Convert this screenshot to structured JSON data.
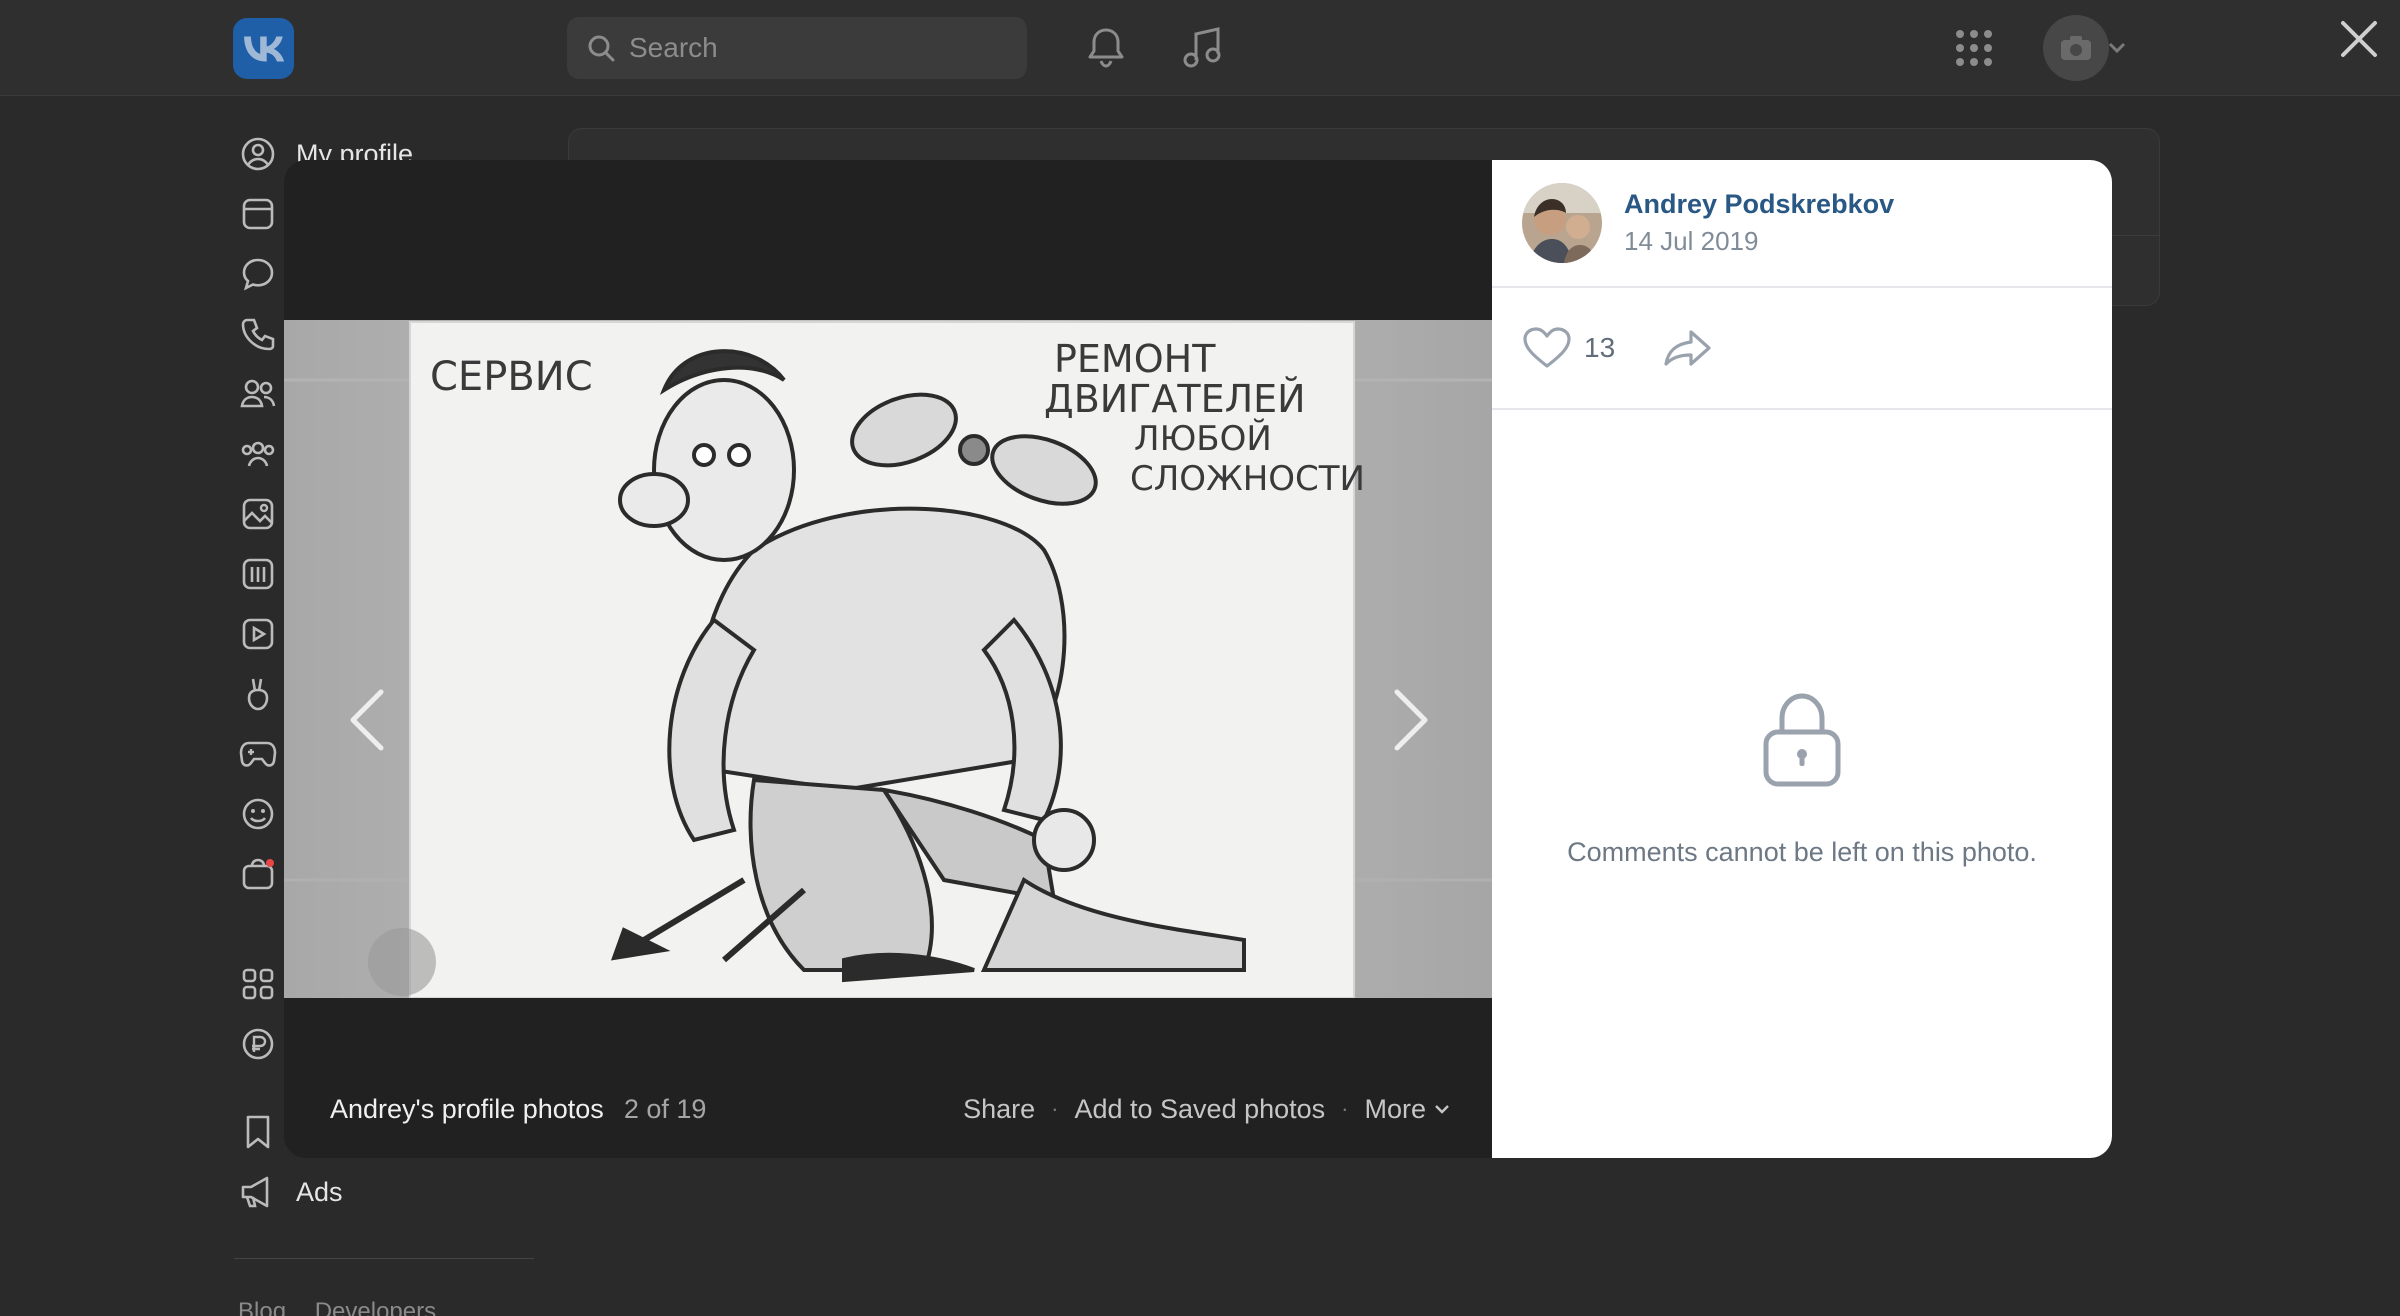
{
  "header": {
    "search_placeholder": "Search"
  },
  "sidebar": {
    "items": [
      {
        "label": "My profile",
        "icon": "user-icon"
      },
      {
        "label": "",
        "icon": "news-icon"
      },
      {
        "label": "",
        "icon": "messenger-icon"
      },
      {
        "label": "",
        "icon": "calls-icon"
      },
      {
        "label": "",
        "icon": "friends-icon"
      },
      {
        "label": "",
        "icon": "communities-icon"
      },
      {
        "label": "",
        "icon": "photos-icon"
      },
      {
        "label": "",
        "icon": "music-icon"
      },
      {
        "label": "",
        "icon": "video-icon"
      },
      {
        "label": "",
        "icon": "clips-icon"
      },
      {
        "label": "",
        "icon": "games-icon"
      },
      {
        "label": "",
        "icon": "stickers-icon"
      },
      {
        "label": "",
        "icon": "market-icon"
      },
      {
        "label": "",
        "icon": "services-icon"
      },
      {
        "label": "",
        "icon": "vk-pay-icon"
      },
      {
        "label": "",
        "icon": "bookmarks-icon"
      },
      {
        "label": "Ads",
        "icon": "megaphone-icon"
      }
    ],
    "footer_links": [
      "Blog",
      "Developers"
    ]
  },
  "viewer": {
    "photo_text": {
      "top_left": "СЕРВИС",
      "top_right_line1": "РЕМОНТ",
      "top_right_line2": "ДВИГАТЕЛЕЙ",
      "top_right_line3": "ЛЮБОЙ",
      "top_right_line4": "СЛОЖНОСТИ"
    },
    "album_title": "Andrey's profile photos",
    "album_count": "2 of 19",
    "actions": {
      "share": "Share",
      "save": "Add to Saved photos",
      "more": "More"
    },
    "author": {
      "name": "Andrey Podskrebkov",
      "date": "14 Jul 2019"
    },
    "likes": "13",
    "comments_locked_text": "Comments cannot be left on this photo."
  },
  "colors": {
    "accent_link": "#2a5885",
    "vk_blue": "#1f5fa8"
  }
}
